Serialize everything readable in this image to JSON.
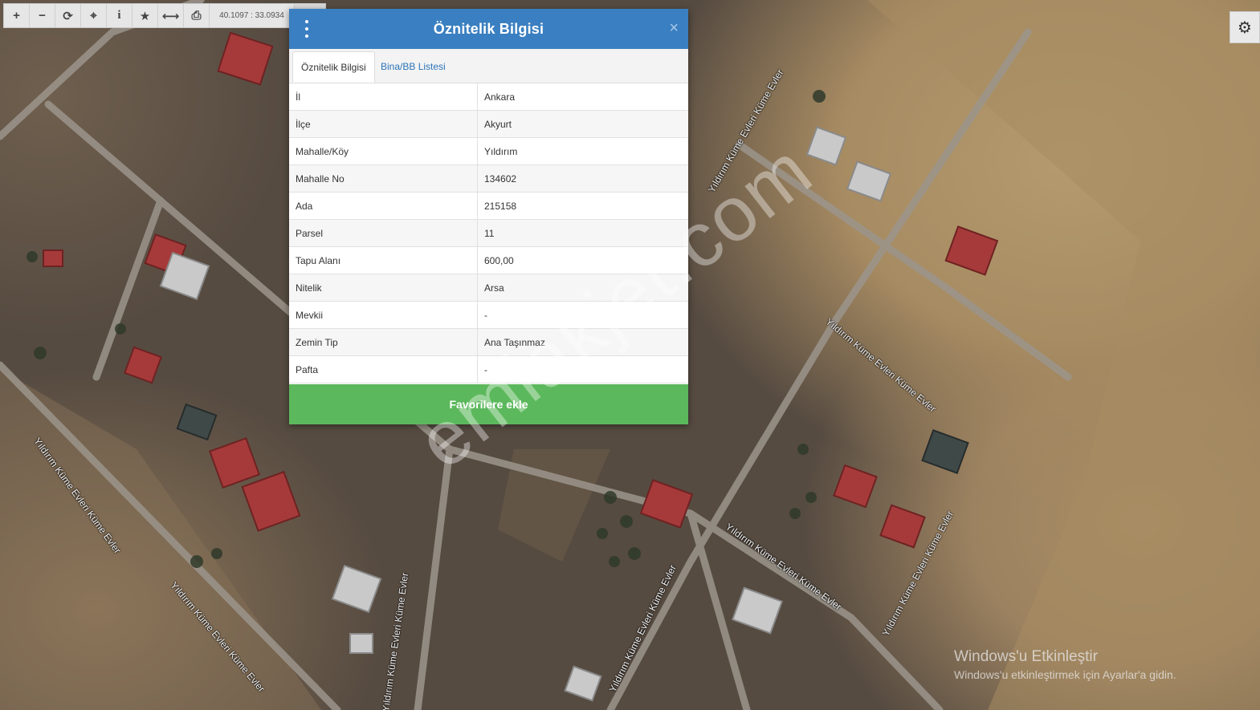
{
  "toolbar": {
    "buttons": [
      {
        "icon": "zoom-in-icon",
        "glyph": "+"
      },
      {
        "icon": "zoom-out-icon",
        "glyph": "−"
      },
      {
        "icon": "refresh-icon",
        "glyph": "⟳"
      },
      {
        "icon": "locate-icon",
        "glyph": "⌖"
      },
      {
        "icon": "info-icon",
        "glyph": "i"
      },
      {
        "icon": "favorite-star-icon",
        "glyph": "★"
      },
      {
        "icon": "measure-icon",
        "glyph": "⟷"
      },
      {
        "icon": "print-icon",
        "glyph": "⎙"
      }
    ],
    "coordinates": "40.1097 : 33.0934"
  },
  "settings": {
    "icon": "gear-icon",
    "glyph": "⚙"
  },
  "dialog": {
    "title": "Öznitelik Bilgisi",
    "close_glyph": "×",
    "tabs": [
      {
        "label": "Öznitelik Bilgisi",
        "active": true
      },
      {
        "label": "Bina/BB Listesi",
        "active": false
      }
    ],
    "rows": [
      {
        "key": "İl",
        "value": "Ankara"
      },
      {
        "key": "İlçe",
        "value": "Akyurt"
      },
      {
        "key": "Mahalle/Köy",
        "value": "Yıldırım"
      },
      {
        "key": "Mahalle No",
        "value": "134602"
      },
      {
        "key": "Ada",
        "value": "215158"
      },
      {
        "key": "Parsel",
        "value": "11"
      },
      {
        "key": "Tapu Alanı",
        "value": "600,00"
      },
      {
        "key": "Nitelik",
        "value": "Arsa"
      },
      {
        "key": "Mevkii",
        "value": "-"
      },
      {
        "key": "Zemin Tip",
        "value": "Ana Taşınmaz"
      },
      {
        "key": "Pafta",
        "value": "-"
      }
    ],
    "favorite_button": "Favorilere ekle",
    "colors": {
      "header": "#3a7fc1",
      "button": "#5cb85c",
      "link": "#2b74b8"
    }
  },
  "map": {
    "road_labels": [
      "Yıldırım Küme Evleri Küme Evler",
      "Yıldırım Küme Evleri Küme Evler",
      "Yıldırım Küme Evleri Küme Evler",
      "Yıldırım Küme Evleri Küme Evler",
      "Yıldırım Küme Evleri Küme Evler",
      "Yıldırım Küme Evleri Küme Evler",
      "Yıldırım Küme Evleri Küme Evler",
      "Yıldırım Küme Evleri Küme Evler"
    ]
  },
  "watermark": "emlakjet.com",
  "windows_activation": {
    "title": "Windows'u Etkinleştir",
    "subtitle": "Windows'u etkinleştirmek için Ayarlar'a gidin."
  }
}
